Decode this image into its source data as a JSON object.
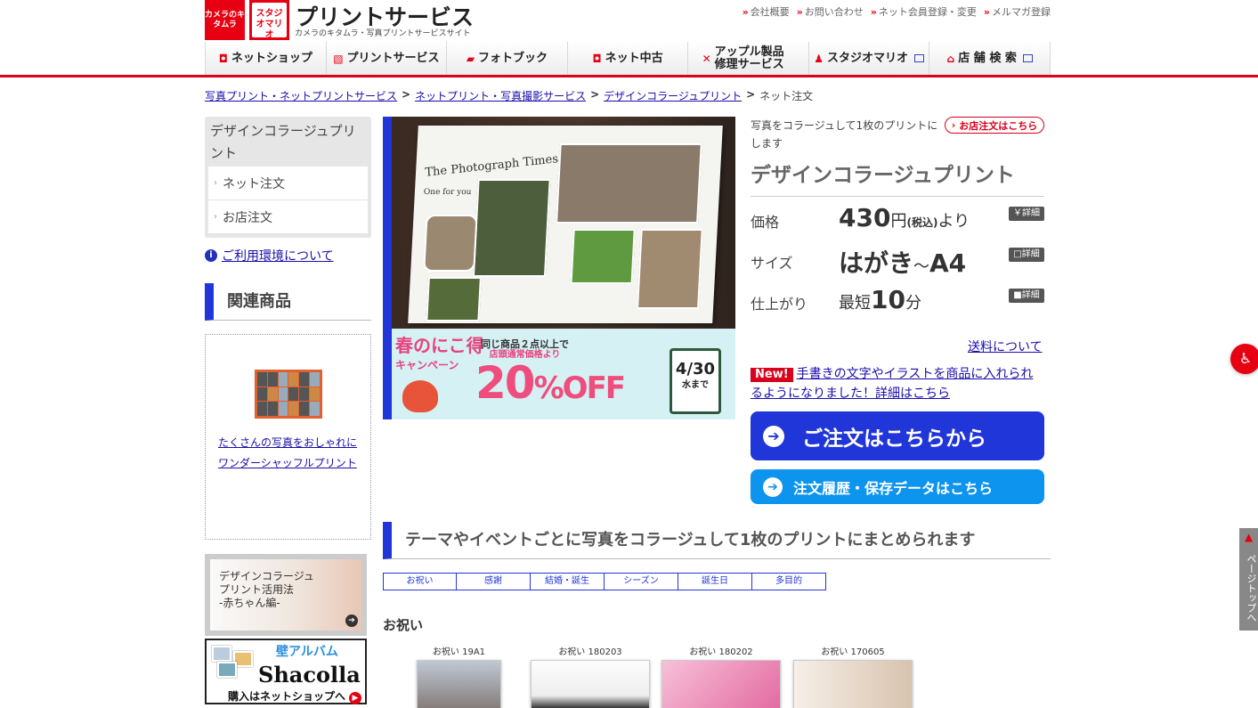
{
  "header": {
    "logo_kitamura": "カメラのキタムラ",
    "logo_mario": "スタジオマリオ",
    "title": "プリントサービス",
    "subtitle": "カメラのキタムラ・写真プリントサービスサイト",
    "util_links": [
      "会社概要",
      "お問い合わせ",
      "ネット会員登録・変更",
      "メルマガ登録"
    ]
  },
  "nav": [
    "ネットショップ",
    "プリントサービス",
    "フォトブック",
    "ネット中古",
    "アップル製品 修理サービス",
    "スタジオマリオ",
    "店 舗 検 索"
  ],
  "breadcrumb": {
    "items": [
      "写真プリント・ネットプリントサービス",
      "ネットプリント・写真撮影サービス",
      "デザインコラージュプリント"
    ],
    "current": "ネット注文",
    "sep": ">"
  },
  "sidebar": {
    "title": "デザインコラージュプリント",
    "items": [
      "ネット注文",
      "お店注文"
    ],
    "env_link": "ご利用環境について",
    "related_title": "関連商品",
    "related_text": "たくさんの写真をおしゃれにワンダーシャッフルプリント",
    "banner_baby": [
      "デザインコラージュ",
      "プリント活用法",
      "-赤ちゃん編-"
    ],
    "banner_shacolla": {
      "top": "壁アルバム",
      "name": "Shacolla",
      "cta": "購入はネットショップへ"
    }
  },
  "hero": {
    "book_title": "The Photograph Times",
    "book_sub": "One for you",
    "promo_title": "春のにこ得",
    "promo_sub": "キャンペーン",
    "promo_note1": "同じ商品２点以上で",
    "promo_note2": "店頭通常価格より",
    "promo_off": "20",
    "promo_off_suffix": "%OFF",
    "promo_date": "4/30",
    "promo_date_sub": "水まで"
  },
  "info": {
    "lead": "写真をコラージュして1枚のプリントにします",
    "store_btn": "お店注文はこちら",
    "product_name": "デザインコラージュプリント",
    "specs": [
      {
        "label": "価格",
        "value_big": "430",
        "value_unit": "円",
        "value_small": "(税込)",
        "value_after": "より",
        "detail": "￥詳細"
      },
      {
        "label": "サイズ",
        "value_big": "はがき",
        "value_unit": "～",
        "value_small": "",
        "value_after": "A4",
        "detail": "□詳細"
      },
      {
        "label": "仕上がり",
        "value_pre": "最短",
        "value_big": "10",
        "value_unit": "分",
        "detail": "■詳細"
      }
    ],
    "shipping_link": "送料について",
    "new_badge": "New!",
    "new_note": "手書きの文字やイラストを商品に入れられるようになりました！詳細はこちら",
    "order_btn": "ご注文はこちらから",
    "history_btn": "注文履歴・保存データはこちら"
  },
  "themes": {
    "heading": "テーマやイベントごとに写真をコラージュして1枚のプリントにまとめられます",
    "tabs": [
      "お祝い",
      "感謝",
      "結婚・誕生",
      "シーズン",
      "誕生日",
      "多目的"
    ],
    "section": "お祝い",
    "designs": [
      "お祝い 19A1",
      "お祝い 180203",
      "お祝い 180202",
      "お祝い 170605"
    ]
  },
  "floating": {
    "page_top": "ページトップへ"
  },
  "colors": {
    "brand_red": "#d9001b",
    "brand_blue": "#2136d8",
    "sky_blue": "#0c94ef"
  }
}
